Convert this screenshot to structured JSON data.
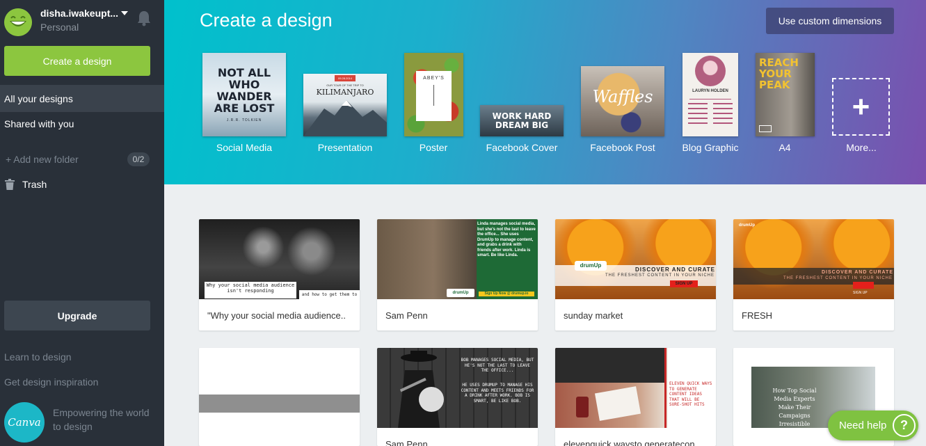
{
  "sidebar": {
    "user_name": "disha.iwakeupt...",
    "account_type": "Personal",
    "create_button": "Create a design",
    "nav": [
      {
        "label": "All your designs",
        "active": true
      },
      {
        "label": "Shared with you",
        "active": false
      }
    ],
    "add_folder": "+ Add new folder",
    "folder_count": "0/2",
    "trash": "Trash",
    "upgrade": "Upgrade",
    "learn": "Learn to design",
    "inspiration": "Get design inspiration",
    "logo_text": "Canva",
    "tagline": "Empowering the world to design"
  },
  "header": {
    "title": "Create a design",
    "custom_button": "Use custom dimensions",
    "templates": [
      {
        "label": "Social Media",
        "thumb_text": "NOT ALL WHO WANDER ARE LOST",
        "thumb_sub": "J.R.R. TOLKIEN"
      },
      {
        "label": "Presentation",
        "thumb_text": "KILIMANJARO",
        "thumb_sub": "OUR TOUR OF THE TRIP TO",
        "thumb_date": "09.28.2014"
      },
      {
        "label": "Poster",
        "thumb_text": "ABEY'S"
      },
      {
        "label": "Facebook Cover",
        "thumb_text": "WORK HARD DREAM BIG"
      },
      {
        "label": "Facebook Post",
        "thumb_text": "Waffles"
      },
      {
        "label": "Blog Graphic",
        "thumb_text": "LAURYN HOLDEN"
      },
      {
        "label": "A4",
        "thumb_text": "REACH YOUR PEAK"
      },
      {
        "label": "More...",
        "thumb_text": "+"
      }
    ]
  },
  "designs": [
    {
      "title": "\"Why your social media audience..",
      "thumb_text": "Why your social media audience isn't responding",
      "thumb_sub": "and how to get them to"
    },
    {
      "title": "Sam Penn",
      "thumb_text": "Linda manages social media, but she's not the last to leave the office... She uses DrumUp to manage content, and grabs a drink with friends after work. Linda is smart. Be like Linda.",
      "thumb_sub": "Sign Up Now @ drumup.io",
      "thumb_brand": "drumUp"
    },
    {
      "title": "sunday market",
      "thumb_text": "DISCOVER AND CURATE",
      "thumb_sub": "THE FRESHEST CONTENT IN YOUR NICHE",
      "thumb_cta": "SIGN UP",
      "thumb_brand": "drumUp"
    },
    {
      "title": "FRESH",
      "thumb_text": "DISCOVER AND CURATE",
      "thumb_sub": "THE FRESHEST CONTENT IN YOUR NICHE",
      "thumb_cta": "SIGN UP",
      "thumb_brand": "drumUp"
    },
    {
      "title": "",
      "thumb_text": ""
    },
    {
      "title": "Sam Penn",
      "thumb_text": "BOB MANAGES SOCIAL MEDIA, BUT HE'S NOT THE LAST TO LEAVE THE OFFICE...",
      "thumb_sub": "HE USES DRUMUP TO MANAGE HIS CONTENT AND MEETS FRIENDS FOR A DRINK AFTER WORK. BOB IS SMART, BE LIKE BOB."
    },
    {
      "title": "elevenquick waysto generatecon",
      "thumb_text": "ELEVEN QUICK WAYS TO GENERATE CONTENT IDEAS THAT WILL BE SURE-SHOT HITS"
    },
    {
      "title": "",
      "thumb_text": "How Top Social Media Experts Make Their Campaigns Irresistible"
    }
  ],
  "help": {
    "label": "Need help",
    "icon": "?"
  }
}
